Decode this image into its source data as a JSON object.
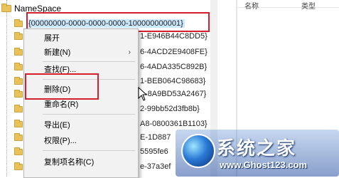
{
  "tree": {
    "root_label": "NameSpace",
    "selected_key": "{00000000-0000-0000-0000-100000000001}",
    "children": [
      "1-E946B44C8DD5}",
      "6-4ACD2E9408FE}",
      "6-4ADA335C892B}",
      "1-BEB064C98683}",
      "-8A9BD53A2467}",
      "2-99bb52d3fb8b}",
      "A8-0800361B1103}",
      "E-1D887",
      "5595fe6",
      "e-37a3ef"
    ]
  },
  "right_header": {
    "col1": "名称",
    "col2": "类型"
  },
  "context_menu": {
    "items": [
      {
        "label": "展开"
      },
      {
        "label": "新建(N)",
        "submenu": true,
        "arrow": "›"
      },
      {
        "label": "查找(F)..."
      },
      {
        "label": "删除(D)"
      },
      {
        "label": "重命名(R)"
      },
      {
        "label": "导出(E)"
      },
      {
        "label": "权限(P)..."
      },
      {
        "label": "复制项名称(C)"
      }
    ]
  },
  "watermark": {
    "title": "系统之家",
    "url": "www.Ghost123.com"
  },
  "colors": {
    "highlight": "#d4202c",
    "selection": "#cce8ff",
    "folder": "#e8c25a"
  }
}
